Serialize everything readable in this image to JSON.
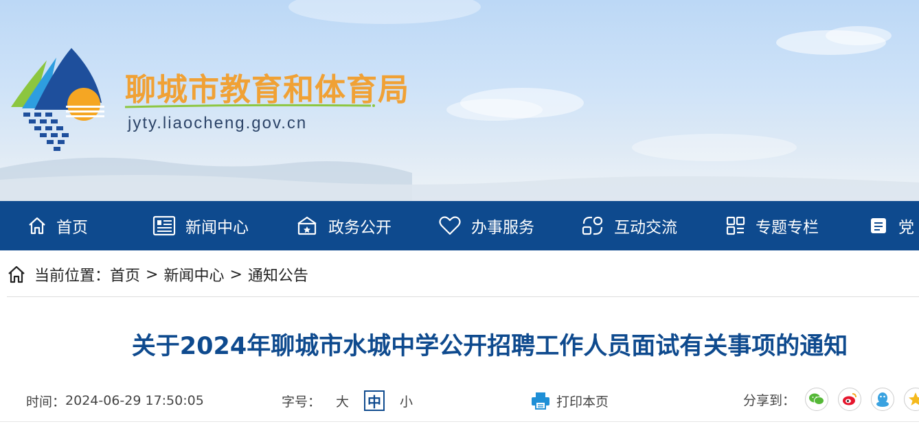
{
  "site": {
    "title": "聊城市教育和体育局",
    "domain": "jyty.liaocheng.gov.cn"
  },
  "nav": {
    "items": [
      {
        "label": "首页",
        "icon": "home-icon"
      },
      {
        "label": "新闻中心",
        "icon": "newspaper-icon"
      },
      {
        "label": "政务公开",
        "icon": "government-building-icon"
      },
      {
        "label": "办事服务",
        "icon": "heart-icon"
      },
      {
        "label": "互动交流",
        "icon": "interaction-icon"
      },
      {
        "label": "专题专栏",
        "icon": "grid-icon"
      },
      {
        "label": "党",
        "icon": "party-icon"
      }
    ]
  },
  "breadcrumb": {
    "prefix": "当前位置：",
    "items": [
      "首页",
      "新闻中心",
      "通知公告"
    ],
    "separator": ">"
  },
  "article": {
    "title": "关于2024年聊城市水城中学公开招聘工作人员面试有关事项的通知",
    "time_label": "时间：",
    "time_value": "2024-06-29 17:50:05",
    "font_size_label": "字号：",
    "font_sizes": [
      "大",
      "中",
      "小"
    ],
    "active_font_size": "中",
    "print_label": "打印本页",
    "share_label": "分享到："
  },
  "share": [
    "wechat-icon",
    "weibo-icon",
    "qq-icon",
    "qzone-icon"
  ],
  "colors": {
    "nav_bg": "#0e4a8e",
    "title_blue": "#0e4a8e",
    "site_title_orange": "#f0a135",
    "wechat": "#55b837",
    "weibo": "#e6162d",
    "qq": "#3aa2e0",
    "qzone": "#f5b91c"
  }
}
